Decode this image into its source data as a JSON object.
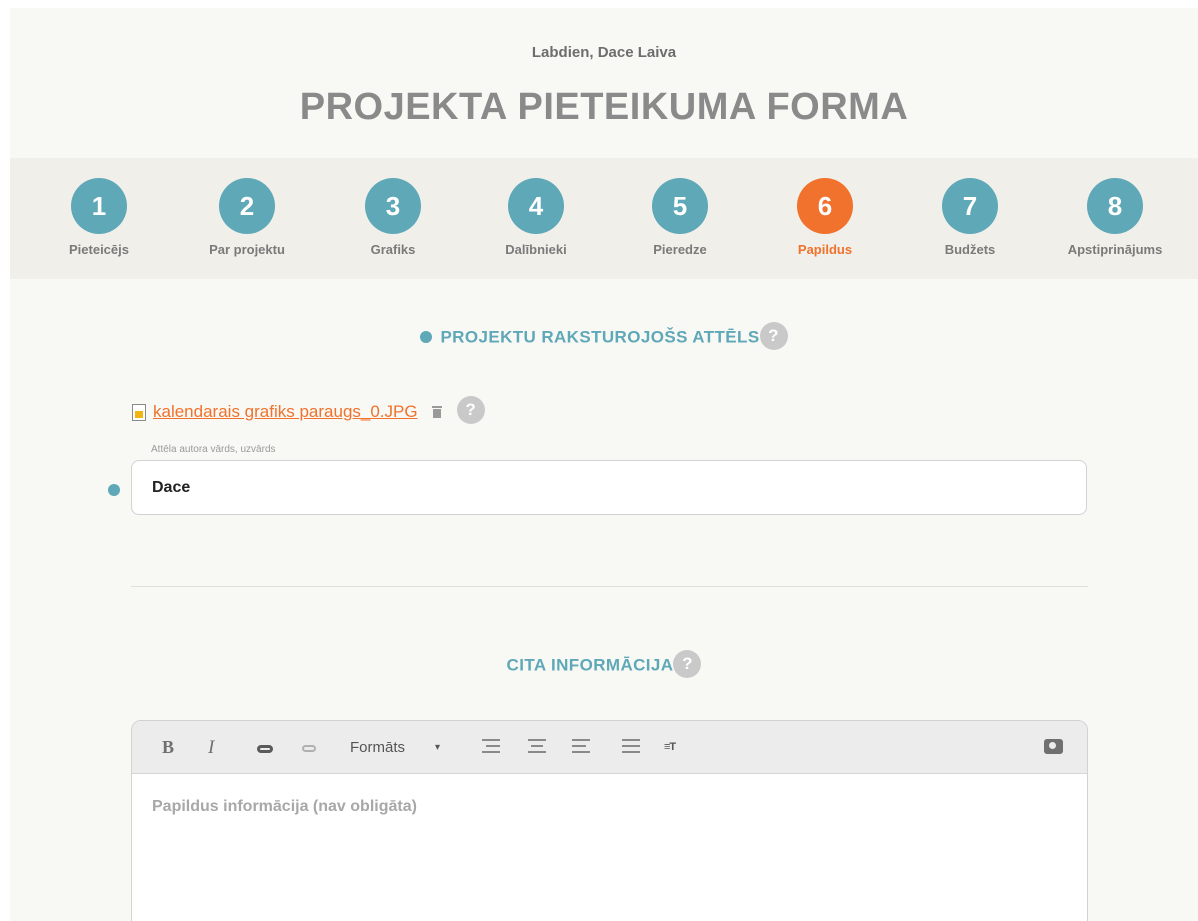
{
  "header": {
    "greeting": "Labdien, Dace Laiva",
    "title": "PROJEKTA PIETEIKUMA FORMA"
  },
  "steps": [
    {
      "number": "1",
      "label": "Pieteicējs"
    },
    {
      "number": "2",
      "label": "Par projektu"
    },
    {
      "number": "3",
      "label": "Grafiks"
    },
    {
      "number": "4",
      "label": "Dalībnieki"
    },
    {
      "number": "5",
      "label": "Pieredze"
    },
    {
      "number": "6",
      "label": "Papildus",
      "active": true
    },
    {
      "number": "7",
      "label": "Budžets"
    },
    {
      "number": "8",
      "label": "Apstiprinājums"
    }
  ],
  "image_section": {
    "title": "PROJEKTU RAKSTUROJOŠS ATTĒLS",
    "help": "?",
    "file_name": "kalendarais grafiks paraugs_0.JPG",
    "file_help": "?",
    "author_label": "Attēla autora vārds, uzvārds",
    "author_value": "Dace"
  },
  "other_section": {
    "title": "CITA INFORMĀCIJA",
    "help": "?",
    "toolbar": {
      "bold": "B",
      "italic": "I",
      "format_label": "Formāts",
      "caret": "▾",
      "clear_format": "≡T"
    },
    "placeholder": "Papildus informācija (nav obligāta)"
  },
  "colors": {
    "accent": "#5ea8b8",
    "active": "#f0722c",
    "background": "#f8f8f5"
  },
  "icons": [
    "file-image-icon",
    "trash-icon",
    "help-icon",
    "link-icon",
    "unlink-icon",
    "align-right-icon",
    "align-center-icon",
    "align-left-icon",
    "list-icon",
    "camera-icon"
  ]
}
